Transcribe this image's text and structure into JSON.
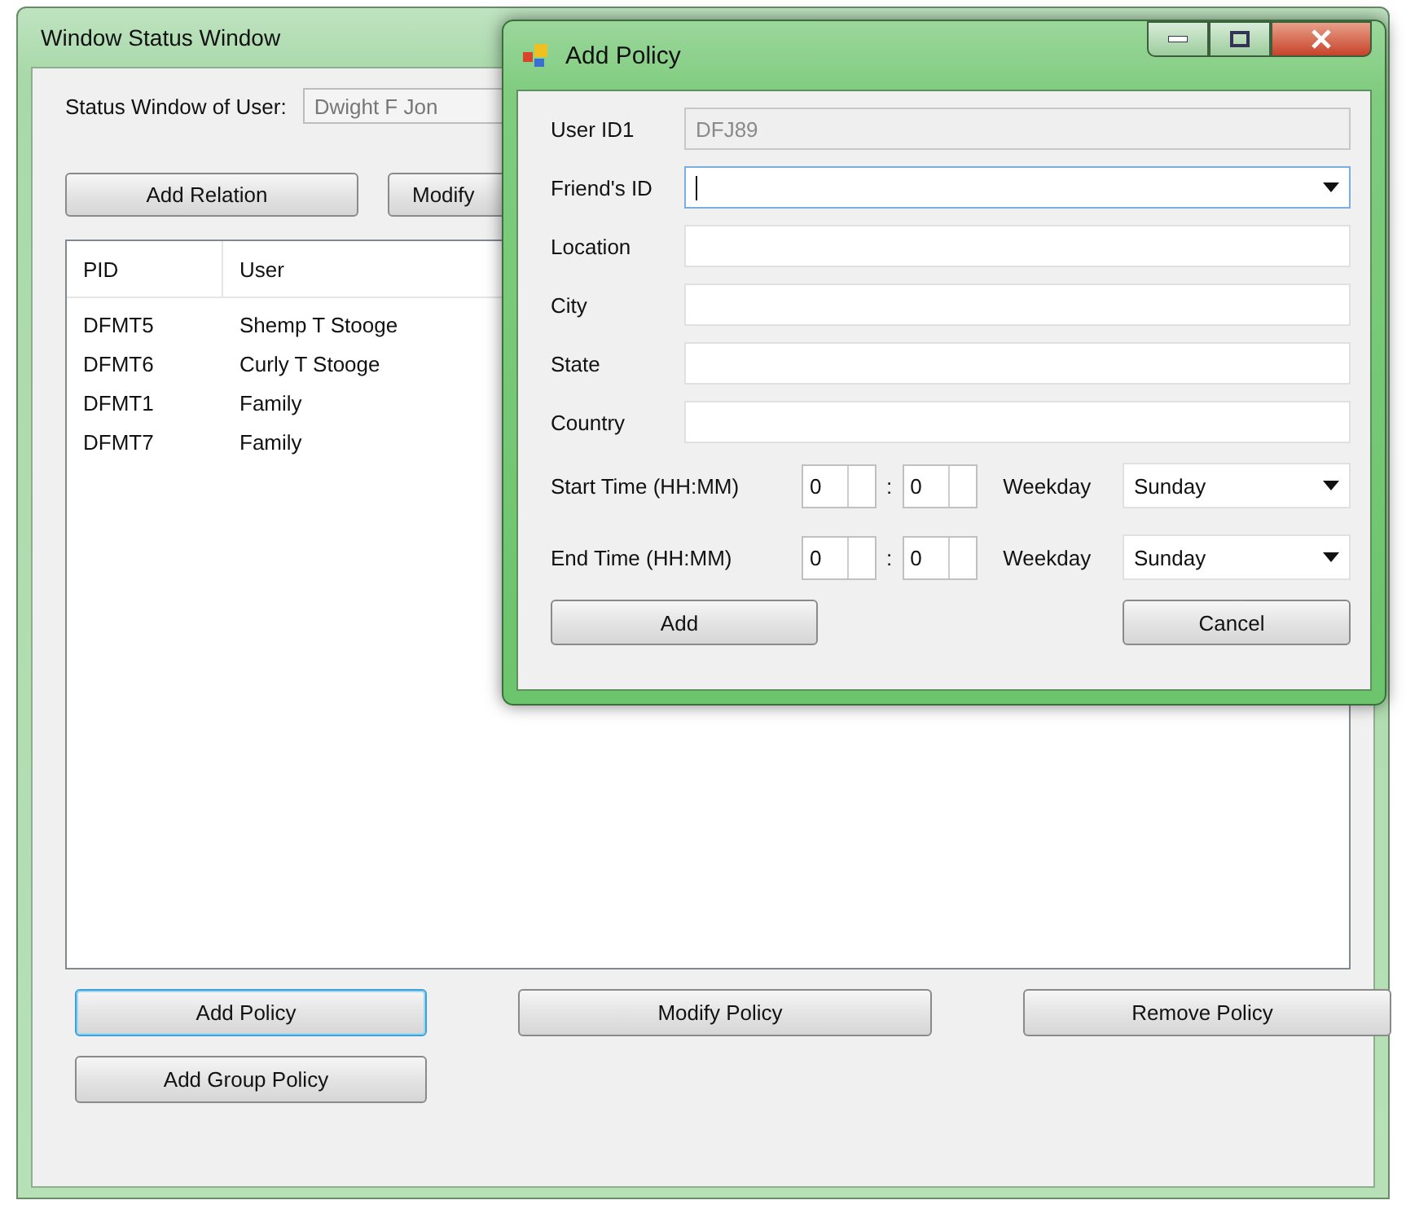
{
  "main_window": {
    "title": "Window Status Window",
    "user_label": "Status Window of User:",
    "user_value": "Dwight F Jon",
    "top_buttons": [
      {
        "label": "Add Relation",
        "cut": false
      },
      {
        "label": "Modify",
        "cut": true
      }
    ],
    "list": {
      "columns": [
        "PID",
        "User"
      ],
      "rows": [
        {
          "pid": "DFMT5",
          "user": "Shemp T Stooge"
        },
        {
          "pid": "DFMT6",
          "user": "Curly T Stooge"
        },
        {
          "pid": "DFMT1",
          "user": "Family"
        },
        {
          "pid": "DFMT7",
          "user": "Family"
        }
      ]
    },
    "bottom_buttons": [
      {
        "label": "Add Policy",
        "focused": true
      },
      {
        "label": "Modify Policy",
        "focused": false
      },
      {
        "label": "Remove Policy",
        "focused": false
      },
      {
        "label": "Add Group Policy",
        "focused": false
      }
    ]
  },
  "dialog": {
    "title": "Add Policy",
    "fields": [
      {
        "label": "User ID1",
        "kind": "readonly",
        "value": "DFJ89",
        "focused": false
      },
      {
        "label": "Friend's ID",
        "kind": "combo",
        "focused": true
      },
      {
        "label": "Location",
        "kind": "text",
        "focused": false
      },
      {
        "label": "City",
        "kind": "text",
        "focused": false
      },
      {
        "label": "State",
        "kind": "text",
        "focused": false
      },
      {
        "label": "Country",
        "kind": "text",
        "focused": false
      }
    ],
    "time_rows": [
      {
        "label": "Start Time (HH:MM)",
        "hours": "0",
        "separator": ":",
        "minutes": "0",
        "weekday_label": "Weekday",
        "weekday": "Sunday"
      },
      {
        "label": "End Time (HH:MM)",
        "hours": "0",
        "separator": ":",
        "minutes": "0",
        "weekday_label": "Weekday",
        "weekday": "Sunday"
      }
    ],
    "buttons": [
      {
        "label": "Add"
      },
      {
        "label": "Cancel"
      }
    ]
  }
}
